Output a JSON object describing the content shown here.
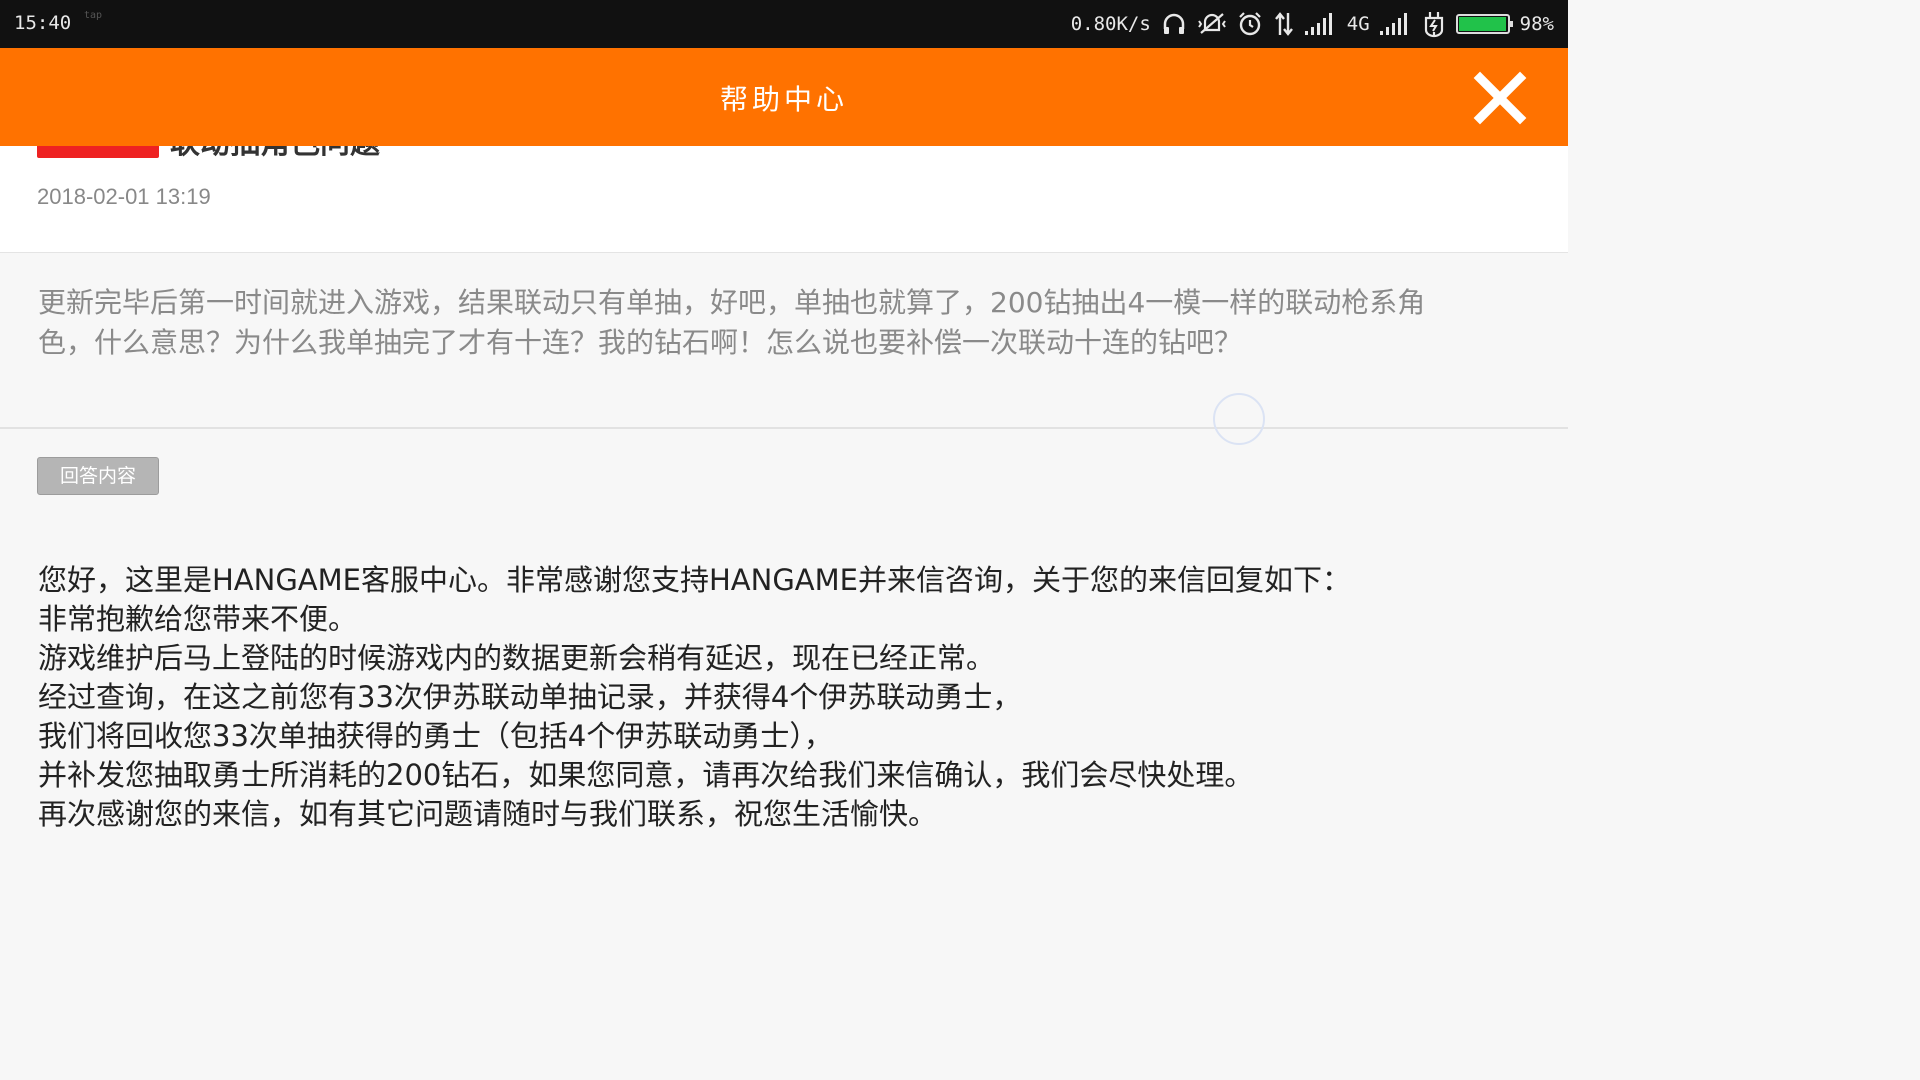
{
  "status_bar": {
    "time": "15:40",
    "tap_label": "tap",
    "net_speed": "0.80K/s",
    "network_type": "4G",
    "battery_level": 0.98,
    "battery_text": "98%",
    "icons": [
      "headset-icon",
      "vibrate-off-icon",
      "alarm-icon",
      "data-transfer-icon",
      "signal-icon",
      "signal-icon",
      "power-saver-icon",
      "battery-icon"
    ]
  },
  "app_bar": {
    "title": "帮助中心",
    "close_icon": "close-icon",
    "background_color": "#ff7200"
  },
  "question_header": {
    "badge_color": "#ee2222",
    "title": "联动抽角色问题",
    "date": "2018-02-01 13:19"
  },
  "question": {
    "text": "更新完毕后第一时间就进入游戏，结果联动只有单抽，好吧，单抽也就算了，200钻抽出4一模一样的联动枪系角色，什么意思？为什么我单抽完了才有十连？我的钻石啊！怎么说也要补偿一次联动十连的钻吧？"
  },
  "answer": {
    "tag": "回答内容",
    "lines": [
      "您好，这里是HANGAME客服中心。非常感谢您支持HANGAME并来信咨询，关于您的来信回复如下：",
      "非常抱歉给您带来不便。",
      "游戏维护后马上登陆的时候游戏内的数据更新会稍有延迟，现在已经正常。",
      "经过查询，在这之前您有33次伊苏联动单抽记录，并获得4个伊苏联动勇士，",
      "我们将回收您33次单抽获得的勇士（包括4个伊苏联动勇士），",
      "并补发您抽取勇士所消耗的200钻石，如果您同意，请再次给我们来信确认，我们会尽快处理。",
      "再次感谢您的来信，如有其它问题请随时与我们联系，祝您生活愉快。"
    ]
  }
}
